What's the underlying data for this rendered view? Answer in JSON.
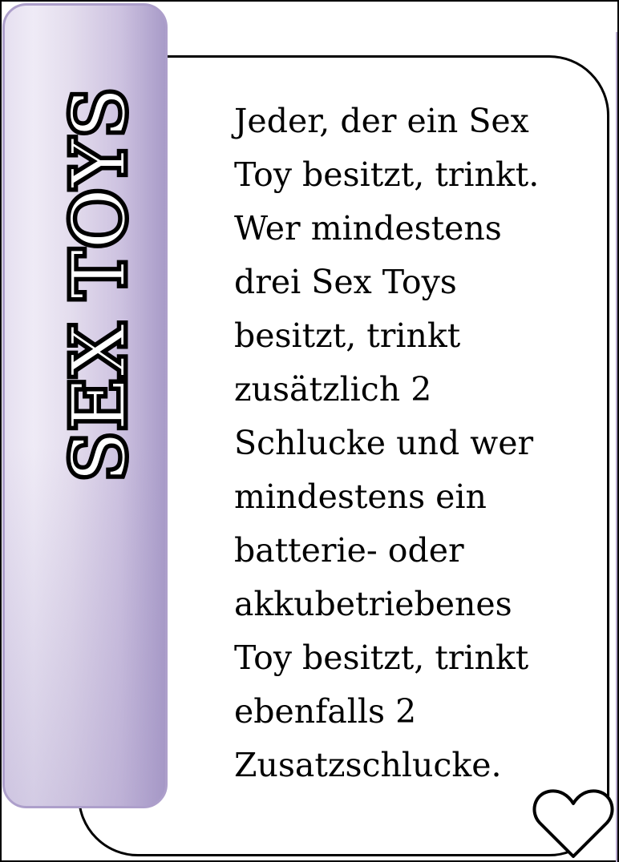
{
  "card": {
    "title": "SEX TOYS",
    "body_lines": [
      "Jeder, der ein Sex",
      "Toy besitzt, trinkt.",
      "Wer mindestens",
      "drei Sex Toys",
      "besitzt, trinkt",
      "zusätzlich 2",
      "Schlucke und wer",
      "mindestens ein",
      "batterie- oder",
      "akkubetriebenes",
      "Toy besitzt,  trinkt",
      "ebenfalls 2",
      "Zusatzschlucke."
    ]
  },
  "colors": {
    "tab_border": "#ad9fcb",
    "tab_gradient_light": "#efebf6",
    "tab_gradient_dark": "#a89bc8",
    "text": "#000000"
  },
  "icons": {
    "corner_icon": "heart-outline-icon"
  }
}
